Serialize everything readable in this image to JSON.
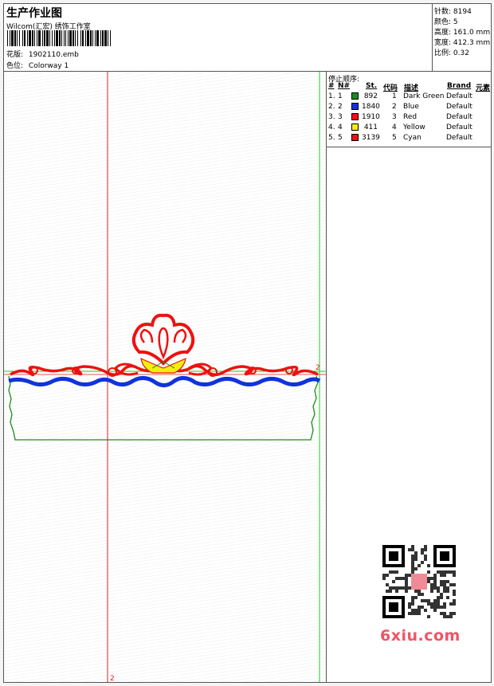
{
  "header": {
    "title": "生产作业图",
    "subtitle": "Wilcom(汇宏) 绣饰工作室",
    "design_label": "花版:",
    "design_value": "1902110.emb",
    "colorway_label": "色位:",
    "colorway_value": "Colorway 1"
  },
  "stats": [
    {
      "label": "针数:",
      "value": "8194"
    },
    {
      "label": "颜色:",
      "value": "5"
    },
    {
      "label": "高度:",
      "value": "161.0 mm"
    },
    {
      "label": "宽度:",
      "value": "412.3 mm"
    },
    {
      "label": "比例:",
      "value": "0.32"
    }
  ],
  "stop_sequence": {
    "heading": "停止顺序:",
    "columns": {
      "num": "#",
      "n": "N#",
      "st": "St.",
      "code": "代码",
      "desc": "描述",
      "brand": "Brand",
      "element": "元素"
    },
    "rows": [
      {
        "num": "1.",
        "n": "1",
        "color": "#1a8c1a",
        "st": "892",
        "code": "1",
        "desc": "Dark Green",
        "brand": "Default"
      },
      {
        "num": "2.",
        "n": "2",
        "color": "#1133dd",
        "st": "1840",
        "code": "2",
        "desc": "Blue",
        "brand": "Default"
      },
      {
        "num": "3.",
        "n": "3",
        "color": "#ee1111",
        "st": "1910",
        "code": "3",
        "desc": "Red",
        "brand": "Default"
      },
      {
        "num": "4.",
        "n": "4",
        "color": "#f2ee10",
        "st": "411",
        "code": "4",
        "desc": "Yellow",
        "brand": "Default"
      },
      {
        "num": "5.",
        "n": "5",
        "color": "#ee1111",
        "st": "3139",
        "code": "5",
        "desc": "Cyan",
        "brand": "Default"
      }
    ]
  },
  "guides": {
    "vertical_label": "2",
    "horizontal_label": "2"
  },
  "colors": {
    "guide_red": "#e02020",
    "guide_green": "#22cc22",
    "red": "#ee1111",
    "blue": "#1133dd",
    "green": "#1a8c1a",
    "yellow": "#f2ee10"
  },
  "watermark": {
    "logo_text": "6xiu.com",
    "qr_icon": "qr-code-icon"
  }
}
